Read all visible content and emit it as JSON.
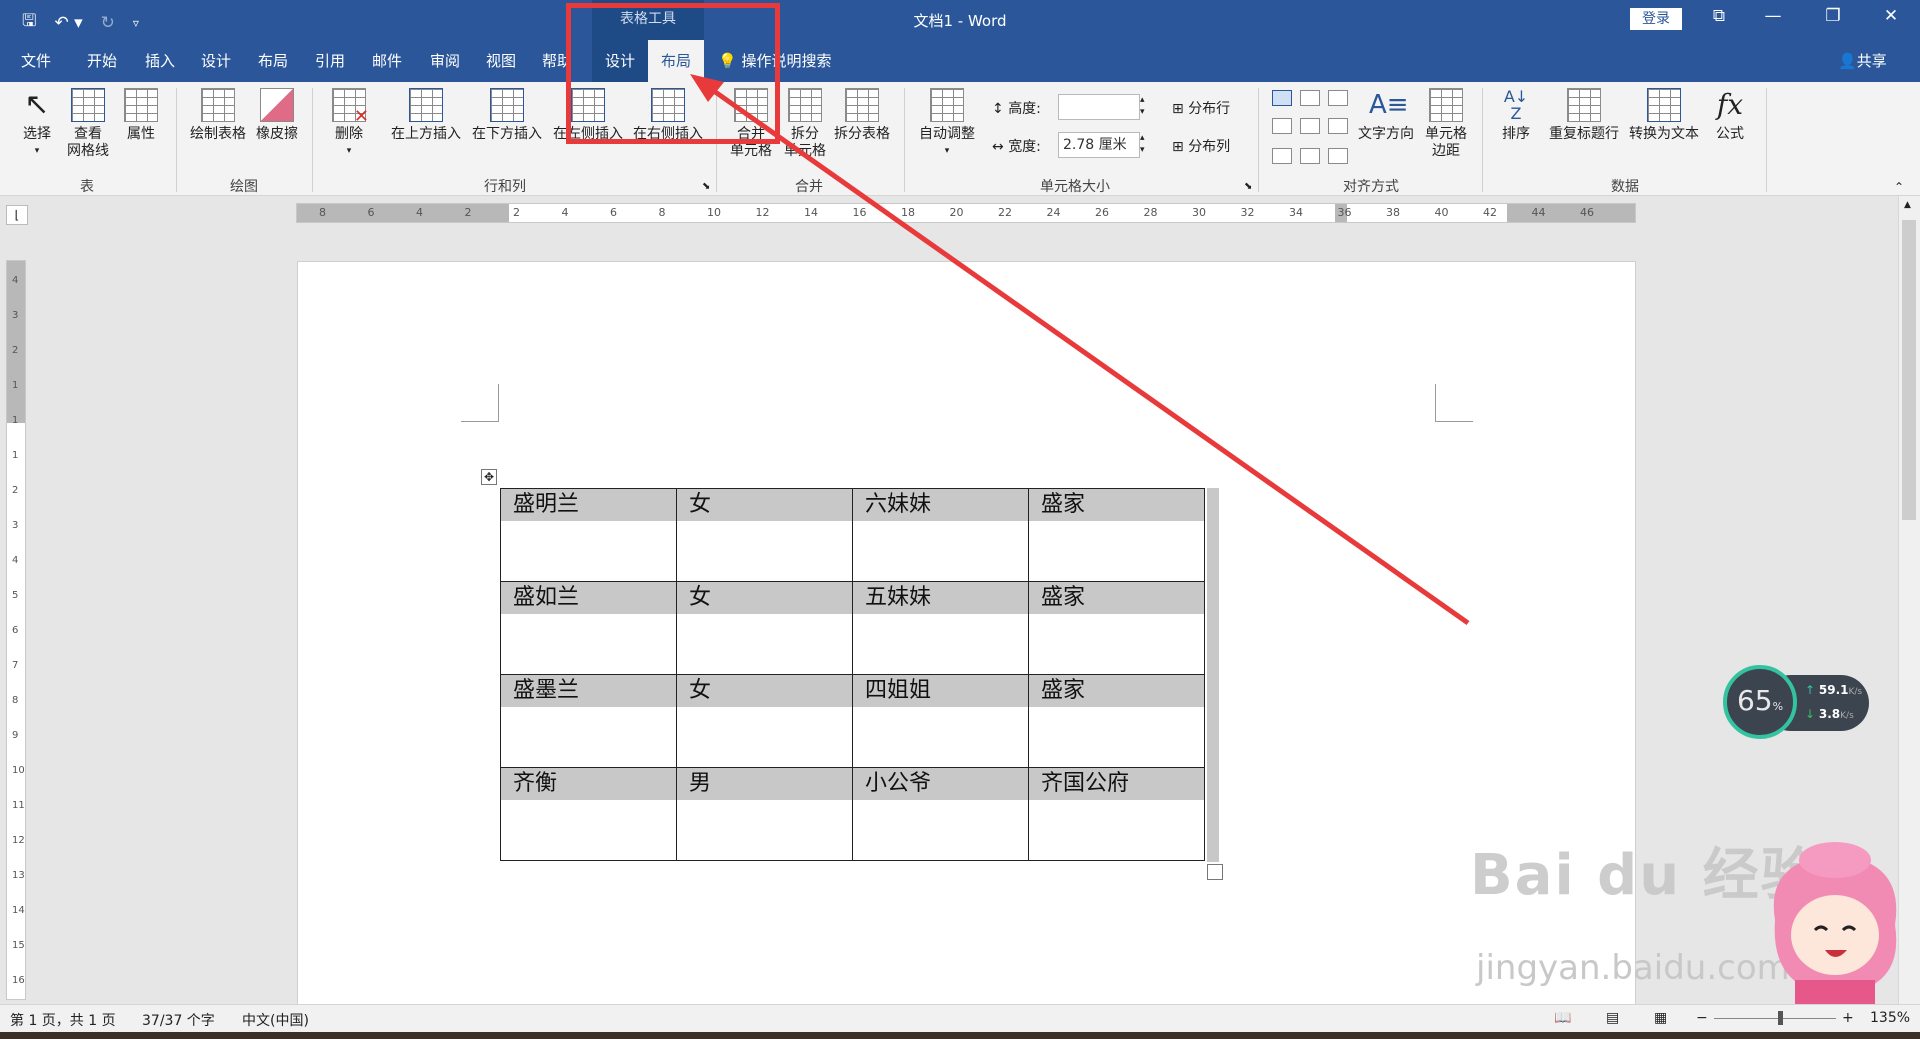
{
  "window": {
    "title": "文档1  -  Word",
    "context_group": "表格工具",
    "login": "登录",
    "controls": [
      "⧉",
      "—",
      "❐",
      "✕"
    ],
    "qat_icons": [
      "save-icon",
      "undo-icon",
      "redo-icon",
      "customize-icon"
    ]
  },
  "tabs": {
    "file": "文件",
    "home": "开始",
    "insert": "插入",
    "design": "设计",
    "layout": "布局",
    "references": "引用",
    "mailings": "邮件",
    "review": "审阅",
    "view": "视图",
    "help": "帮助",
    "table_design": "设计",
    "table_layout": "布局",
    "tell_me": "操作说明搜索",
    "share": "共享"
  },
  "ribbon": {
    "table": {
      "select": "选择",
      "view_gridlines_1": "查看",
      "view_gridlines_2": "网格线",
      "properties": "属性",
      "label": "表"
    },
    "draw": {
      "draw_table": "绘制表格",
      "eraser": "橡皮擦",
      "label": "绘图"
    },
    "rows_cols": {
      "delete": "删除",
      "insert_above": "在上方插入",
      "insert_below": "在下方插入",
      "insert_left": "在左侧插入",
      "insert_right": "在右侧插入",
      "label": "行和列"
    },
    "merge": {
      "merge_cells_1": "合并",
      "merge_cells_2": "单元格",
      "split_cells_1": "拆分",
      "split_cells_2": "单元格",
      "split_table": "拆分表格",
      "label": "合并"
    },
    "cell_size": {
      "autofit": "自动调整",
      "height_label": "高度:",
      "height_value": "",
      "width_label": "宽度:",
      "width_value": "2.78 厘米",
      "distribute_rows": "分布行",
      "distribute_cols": "分布列",
      "label": "单元格大小"
    },
    "alignment": {
      "text_direction": "文字方向",
      "cell_margins_1": "单元格",
      "cell_margins_2": "边距",
      "label": "对齐方式"
    },
    "data": {
      "sort": "排序",
      "repeat_header": "重复标题行",
      "convert_text": "转换为文本",
      "formula": "公式",
      "label": "数据"
    }
  },
  "hruler": {
    "labels": [
      "8",
      "6",
      "4",
      "2",
      "2",
      "4",
      "6",
      "8",
      "10",
      "12",
      "14",
      "16",
      "18",
      "20",
      "22",
      "24",
      "26",
      "28",
      "30",
      "32",
      "34",
      "36",
      "38",
      "40",
      "42",
      "44",
      "46"
    ]
  },
  "vruler": {
    "labels": [
      "4",
      "3",
      "2",
      "1",
      "1",
      "1",
      "2",
      "3",
      "4",
      "5",
      "6",
      "7",
      "8",
      "9",
      "10",
      "11",
      "12",
      "13",
      "14",
      "15",
      "16"
    ]
  },
  "table": {
    "rows": [
      [
        "盛明兰",
        "女",
        "六妹妹",
        "盛家"
      ],
      [
        "盛如兰",
        "女",
        "五妹妹",
        "盛家"
      ],
      [
        "盛墨兰",
        "女",
        "四姐姐",
        "盛家"
      ],
      [
        "齐衡",
        "男",
        "小公爷",
        "齐国公府"
      ]
    ]
  },
  "speed_widget": {
    "percent": "65",
    "unit": "%",
    "up": "59.1",
    "down": "3.8",
    "rate_unit": "K/s"
  },
  "watermark": {
    "brand": "Bai du 经验",
    "url": "jingyan.baidu.com"
  },
  "status": {
    "page": "第 1 页，共 1 页",
    "words": "37/37 个字",
    "lang": "中文(中国)",
    "zoom": "135%"
  },
  "colors": {
    "accent": "#2b579a",
    "annotation": "#e83a3a"
  }
}
